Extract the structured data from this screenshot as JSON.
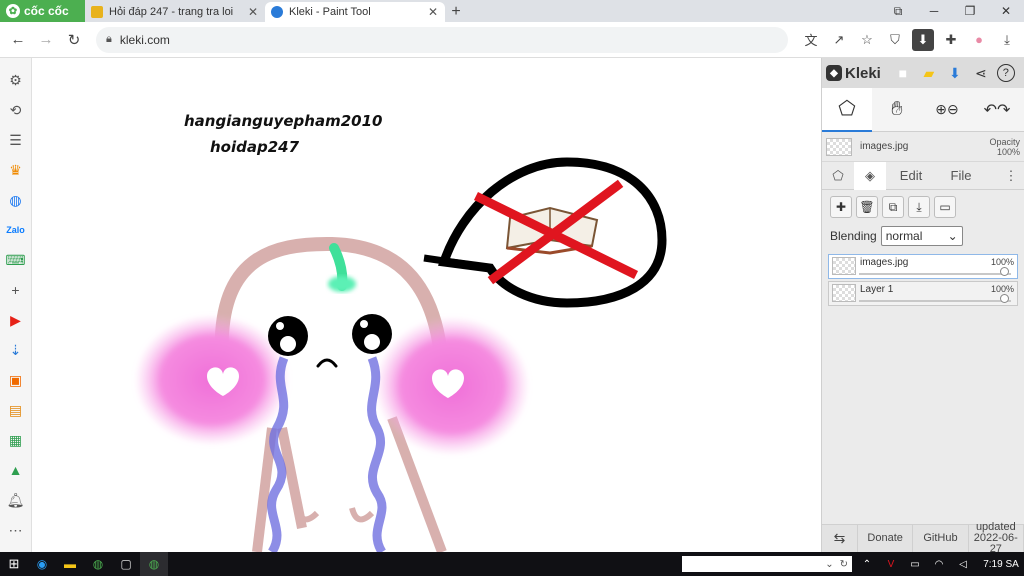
{
  "browser": {
    "brand_label": "cốc cốc",
    "tabs": [
      {
        "title": "Hỏi đáp 247 - trang tra loi",
        "active": false,
        "favicon_color": "#e8b21c"
      },
      {
        "title": "Kleki - Paint Tool",
        "active": true,
        "favicon_color": "#2a7bd8"
      }
    ],
    "new_tab_icon": "plus-icon",
    "window_controls": [
      "minimize",
      "restore",
      "close"
    ],
    "url": "kleki.com"
  },
  "sidebar_icons": [
    "settings-icon",
    "history-icon",
    "list-icon",
    "crown-icon",
    "messenger-icon",
    "zalo-icon",
    "game-icon",
    "add-icon",
    "youtube-icon",
    "download-icon",
    "app-icon",
    "shop-icon",
    "sheet-icon",
    "hat-icon",
    "bell-icon",
    "more-icon"
  ],
  "canvas": {
    "credit_line1": "hangianguyepham2010",
    "credit_line2": "hoidap247"
  },
  "kleki": {
    "app_name": "Kleki",
    "layer_header": {
      "name": "images.jpg",
      "opacity_label": "Opacity",
      "opacity_value": "100%"
    },
    "tabs": {
      "edit": "Edit",
      "file": "File"
    },
    "blending_label": "Blending",
    "blending_value": "normal",
    "layers": [
      {
        "name": "images.jpg",
        "opacity": "100%",
        "active": true
      },
      {
        "name": "Layer 1",
        "opacity": "100%",
        "active": false
      }
    ],
    "footer": {
      "donate": "Donate",
      "github": "GitHub",
      "updated_label": "updated",
      "updated_date": "2022-06-27"
    }
  },
  "taskbar": {
    "clock": "7:19 SA"
  }
}
